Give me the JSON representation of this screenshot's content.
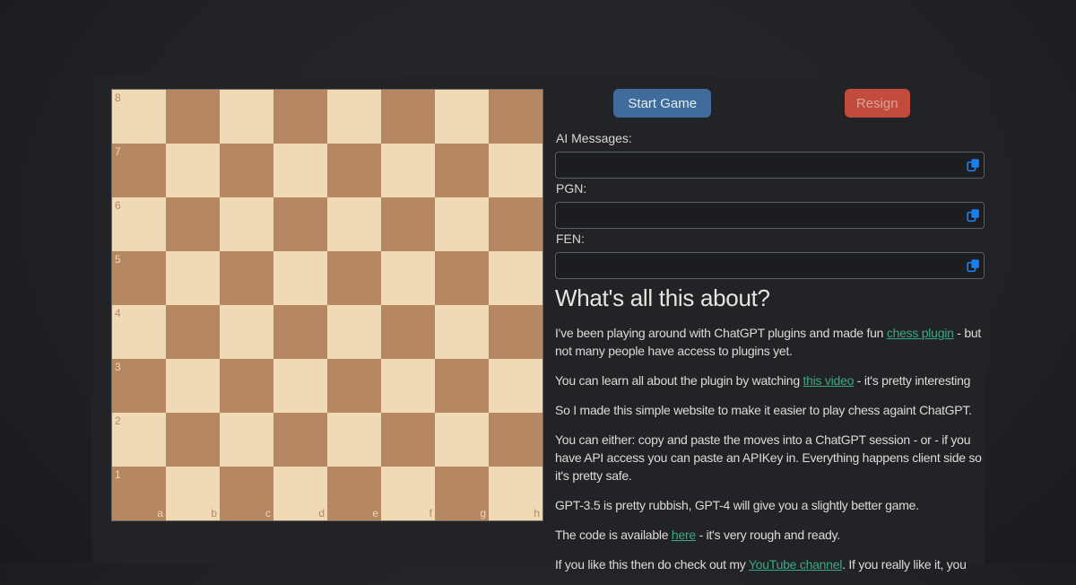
{
  "colors": {
    "board_light": "#f0d9b5",
    "board_dark": "#b58863",
    "start_button_bg": "#3f6c9b",
    "resign_button_bg": "#c14b3c",
    "link": "#3aa981",
    "copy_icon": "#1a7ef3"
  },
  "board": {
    "files": [
      "a",
      "b",
      "c",
      "d",
      "e",
      "f",
      "g",
      "h"
    ],
    "ranks": [
      "8",
      "7",
      "6",
      "5",
      "4",
      "3",
      "2",
      "1"
    ]
  },
  "controls": {
    "start_label": "Start Game",
    "resign_label": "Resign"
  },
  "fields": [
    {
      "name": "ai-messages",
      "label": "AI Messages:",
      "value": ""
    },
    {
      "name": "pgn",
      "label": "PGN:",
      "value": ""
    },
    {
      "name": "fen",
      "label": "FEN:",
      "value": ""
    }
  ],
  "about": {
    "heading": "What's all this about?",
    "paragraphs": [
      [
        {
          "text": "I've been playing around with ChatGPT plugins and made fun "
        },
        {
          "text": "chess plugin",
          "link": true,
          "name": "chess-plugin-link"
        },
        {
          "text": " - but not many people have access to plugins yet."
        }
      ],
      [
        {
          "text": "You can learn all about the plugin by watching "
        },
        {
          "text": "this video",
          "link": true,
          "name": "this-video-link"
        },
        {
          "text": " - it's pretty interesting"
        }
      ],
      [
        {
          "text": "So I made this simple website to make it easier to play chess againt ChatGPT."
        }
      ],
      [
        {
          "text": "You can either: copy and paste the moves into a ChatGPT session - or - if you have API access you can paste an APIKey in. Everything happens client side so it's pretty safe."
        }
      ],
      [
        {
          "text": "GPT-3.5 is pretty rubbish, GPT-4 will give you a slightly better game."
        }
      ],
      [
        {
          "text": "The code is available "
        },
        {
          "text": "here",
          "link": true,
          "name": "here-link"
        },
        {
          "text": " - it's very rough and ready."
        }
      ],
      [
        {
          "text": "If you like this then do check out my "
        },
        {
          "text": "YouTube channel",
          "link": true,
          "name": "youtube-channel-link"
        },
        {
          "text": ". If you really like it, you"
        }
      ]
    ]
  }
}
